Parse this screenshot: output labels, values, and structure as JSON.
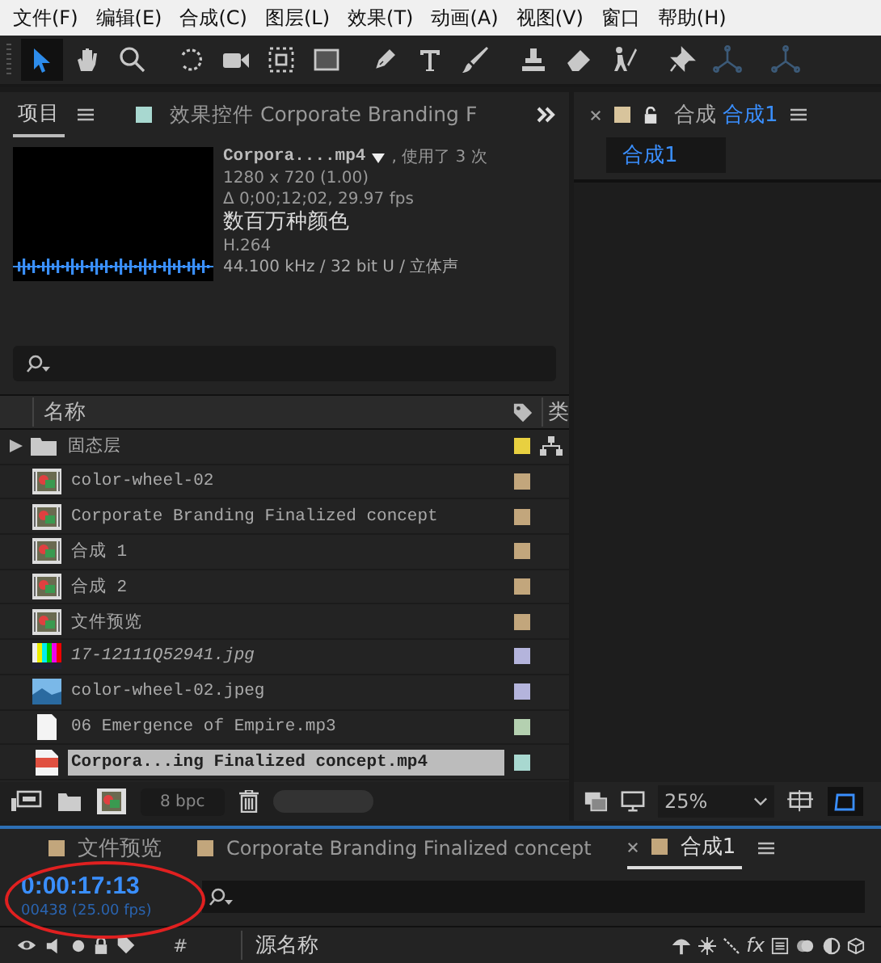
{
  "menu": [
    "文件(F)",
    "编辑(E)",
    "合成(C)",
    "图层(L)",
    "效果(T)",
    "动画(A)",
    "视图(V)",
    "窗口",
    "帮助(H)"
  ],
  "tools": [
    {
      "kind": "select",
      "selected": true,
      "disabled": false
    },
    {
      "kind": "hand",
      "selected": false,
      "disabled": false
    },
    {
      "kind": "zoom",
      "selected": false,
      "disabled": false
    },
    {
      "kind": "rotate",
      "selected": false,
      "disabled": false
    },
    {
      "kind": "camera",
      "selected": false,
      "disabled": false
    },
    {
      "kind": "pan",
      "selected": false,
      "disabled": false
    },
    {
      "kind": "rect",
      "selected": false,
      "disabled": false
    },
    {
      "kind": "pen",
      "selected": false,
      "disabled": false
    },
    {
      "kind": "text",
      "selected": false,
      "disabled": false
    },
    {
      "kind": "brush",
      "selected": false,
      "disabled": false
    },
    {
      "kind": "stamp",
      "selected": false,
      "disabled": false
    },
    {
      "kind": "eraser",
      "selected": false,
      "disabled": false
    },
    {
      "kind": "puppet",
      "selected": false,
      "disabled": false
    },
    {
      "kind": "pin",
      "selected": false,
      "disabled": false
    },
    {
      "kind": "axis",
      "selected": false,
      "disabled": true
    },
    {
      "kind": "axis",
      "selected": false,
      "disabled": true
    }
  ],
  "project_panel": {
    "tabs": [
      {
        "label": "项目",
        "selected": true
      },
      {
        "label": "效果控件 Corporate Branding F",
        "selected": false,
        "color": "#a8d8d0"
      }
    ],
    "info": {
      "file_name": "Corpora....mp4",
      "usage": ", 使用了 3 次",
      "lines": [
        "1280 x 720 (1.00)",
        "Δ 0;00;12;02, 29.97 fps"
      ],
      "color_depth": "数百万种颜色",
      "codec": "H.264",
      "audio": "44.100 kHz / 32 bit U / 立体声"
    },
    "columns": {
      "name": "名称",
      "column_3": "类"
    },
    "items": [
      {
        "kind": "folder",
        "name": "固态层",
        "color": "#e8d040",
        "selected": false,
        "missing": false,
        "expanded": false
      },
      {
        "kind": "comp",
        "name": "color-wheel-02",
        "color": "#c2a67c",
        "selected": false,
        "missing": false
      },
      {
        "kind": "comp",
        "name": "Corporate Branding  Finalized concept",
        "color": "#c2a67c",
        "selected": false,
        "missing": false
      },
      {
        "kind": "comp",
        "name": "合成 1",
        "color": "#c2a67c",
        "selected": false,
        "missing": false
      },
      {
        "kind": "comp",
        "name": "合成 2",
        "color": "#c2a67c",
        "selected": false,
        "missing": false
      },
      {
        "kind": "comp",
        "name": "文件预览",
        "color": "#c2a67c",
        "selected": false,
        "missing": false
      },
      {
        "kind": "colorbars",
        "name": "17-12111Q52941.jpg",
        "color": "#b4b4dc",
        "selected": false,
        "missing": true
      },
      {
        "kind": "image",
        "name": "color-wheel-02.jpeg",
        "color": "#b4b4dc",
        "selected": false,
        "missing": false
      },
      {
        "kind": "audio",
        "name": "06 Emergence of Empire.mp3",
        "color": "#b4d0b0",
        "selected": false,
        "missing": false
      },
      {
        "kind": "video",
        "name": "Corpora...ing  Finalized concept.mp4",
        "color": "#a8d8d0",
        "selected": true,
        "missing": false
      }
    ],
    "bit_depth": "8 bpc"
  },
  "composition_panel": {
    "tab_prefix": "合成",
    "comp_name": "合成1",
    "chip": "合成1",
    "zoom": "25%"
  },
  "timeline": {
    "tabs": [
      {
        "label": "文件预览",
        "color": "#c2a67c",
        "selected": false
      },
      {
        "label": "Corporate Branding  Finalized concept",
        "color": "#c2a67c",
        "selected": false
      },
      {
        "label": "合成1",
        "color": "#c2a67c",
        "selected": true
      }
    ],
    "timecode": "0:00:17:13",
    "frame_info": "00438 (25.00 fps)",
    "columns": {
      "number": "#",
      "source_name": "源名称",
      "fx": "fx"
    }
  }
}
